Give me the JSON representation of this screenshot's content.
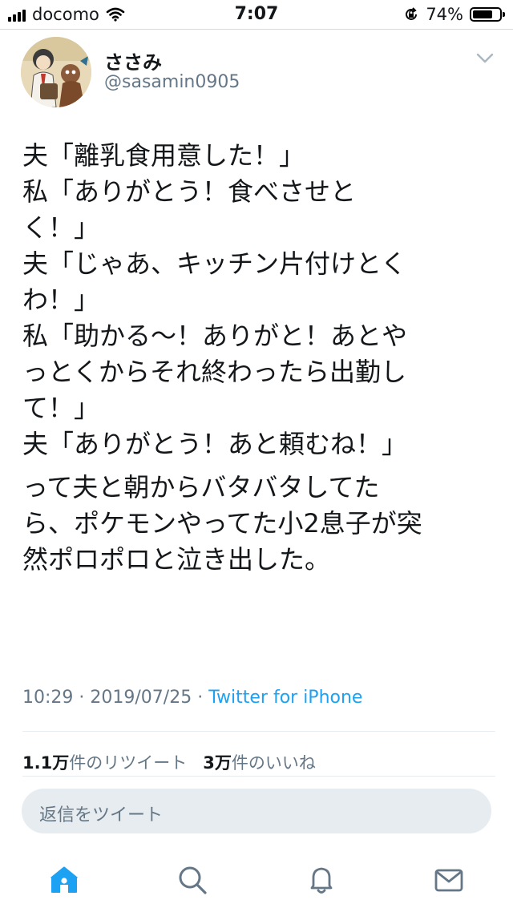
{
  "status_bar": {
    "carrier": "docomo",
    "time": "7:07",
    "battery_percent": "74%",
    "battery_level": 0.74
  },
  "tweet": {
    "display_name": "ささみ",
    "handle": "@sasamin0905",
    "lines_1": [
      "夫「離乳食用意した！」",
      "私「ありがとう！食べさせと",
      "く！」",
      "夫「じゃあ、キッチン片付けとく",
      "わ！」",
      "私「助かる〜！ありがと！あとや",
      "っとくからそれ終わったら出勤し",
      "て！」",
      "夫「ありがとう！あと頼むね！」"
    ],
    "lines_2": [
      "って夫と朝からバタバタしてた",
      "ら、ポケモンやってた小2息子が突",
      "然ポロポロと泣き出した。"
    ],
    "time": "10:29",
    "date": "2019/07/25",
    "source": "Twitter for iPhone"
  },
  "stats": {
    "retweet_count": "1.1万",
    "retweet_label": "件のリツイート",
    "like_count": "3万",
    "like_label": "件のいいね"
  },
  "reply": {
    "placeholder": "返信をツイート"
  },
  "tabbar": {
    "accent_color": "#1da1f2",
    "icons": [
      "home-icon",
      "search-icon",
      "notifications-icon",
      "messages-icon"
    ],
    "active": "home-icon"
  }
}
